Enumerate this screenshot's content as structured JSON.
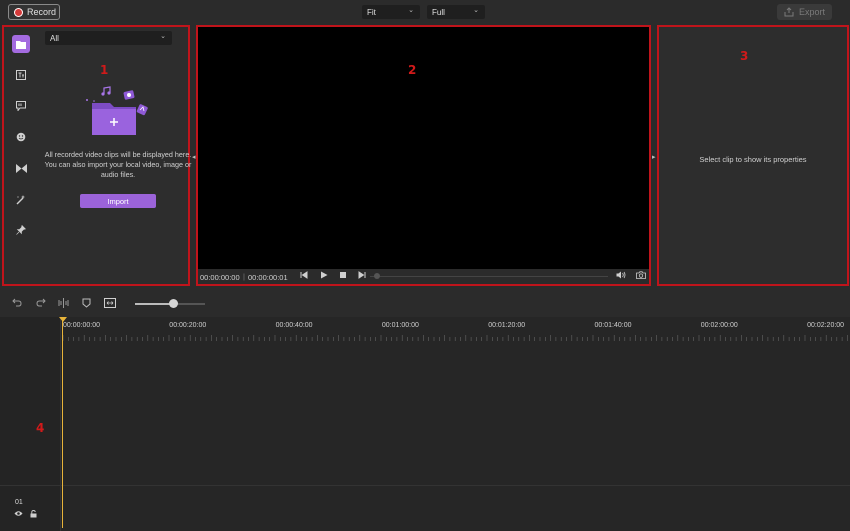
{
  "topbar": {
    "record_label": "Record",
    "fit_select": "Fit",
    "full_select": "Full",
    "export_label": "Export"
  },
  "annotations": {
    "n1": "1",
    "n2": "2",
    "n3": "3",
    "n4": "4"
  },
  "media": {
    "filter": "All",
    "empty_message": "All recorded video clips will be displayed here. You can also import your local video, image or audio files.",
    "import_label": "Import",
    "sidebar_icons": [
      "media-icon",
      "text-icon",
      "caption-icon",
      "sticker-icon",
      "transition-icon",
      "effects-icon",
      "pin-icon"
    ]
  },
  "player": {
    "current_time": "00:00:00:00",
    "total_time": "00:00:00:01"
  },
  "properties": {
    "placeholder": "Select clip to show its properties"
  },
  "timeline": {
    "ruler": [
      "00:00:00:00",
      "00:00:20:00",
      "00:00:40:00",
      "00:01:00:00",
      "00:01:20:00",
      "00:01:40:00",
      "00:02:00:00",
      "00:02:20:00"
    ],
    "zoom_level": 0.55,
    "track_number": "01"
  },
  "colors": {
    "accent": "#9b63d9",
    "highlight_border": "#c0141b",
    "playhead": "#e8b43a"
  }
}
